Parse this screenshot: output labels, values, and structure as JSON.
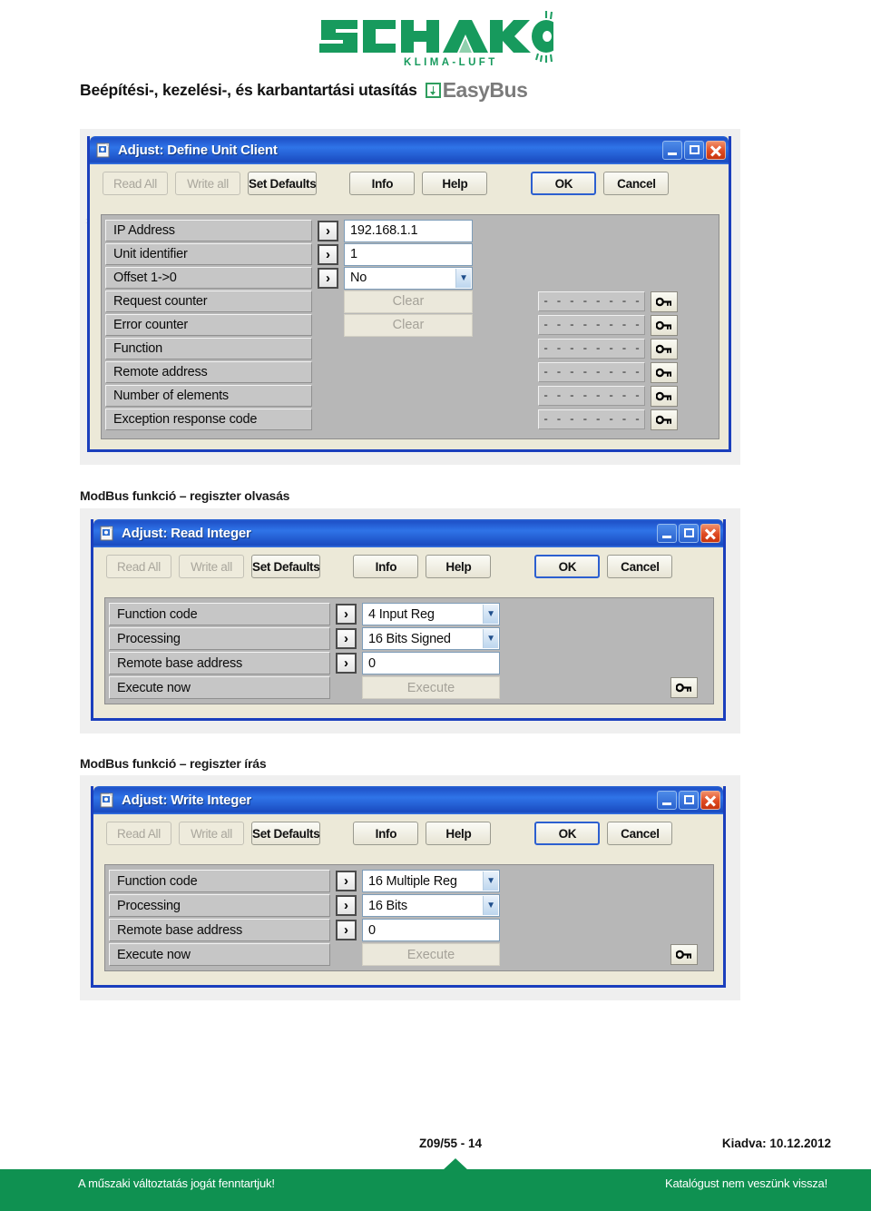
{
  "brand": {
    "logo_text": "SCHAKO",
    "logo_tagline": "KLIMA-LUFT",
    "logo_color": "#179a5d"
  },
  "header": {
    "title": "Beépítési-, kezelési-, és karbantartási utasítás",
    "product": "EasyBus",
    "product_icon": "easybus-mark-icon"
  },
  "toolbar_labels": {
    "read_all": "Read All",
    "write_all": "Write all",
    "set_defaults": "Set Defaults",
    "info": "Info",
    "help": "Help",
    "ok": "OK",
    "cancel": "Cancel"
  },
  "windows": [
    {
      "title": "Adjust: Define Unit Client",
      "rows": [
        {
          "label": "IP Address",
          "control": "text",
          "value": "192.168.1.1",
          "arrow": true,
          "dash": false,
          "key": false
        },
        {
          "label": "Unit identifier",
          "control": "text",
          "value": "1",
          "arrow": true,
          "dash": false,
          "key": false
        },
        {
          "label": "Offset 1->0",
          "control": "combo",
          "value": "No",
          "arrow": true,
          "dash": false,
          "key": false
        },
        {
          "label": "Request counter",
          "control": "button",
          "value": "Clear",
          "arrow": false,
          "dash": true,
          "key": true
        },
        {
          "label": "Error counter",
          "control": "button",
          "value": "Clear",
          "arrow": false,
          "dash": true,
          "key": true
        },
        {
          "label": "Function",
          "control": "none",
          "value": "",
          "arrow": false,
          "dash": true,
          "key": true
        },
        {
          "label": "Remote address",
          "control": "none",
          "value": "",
          "arrow": false,
          "dash": true,
          "key": true
        },
        {
          "label": "Number of elements",
          "control": "none",
          "value": "",
          "arrow": false,
          "dash": true,
          "key": true
        },
        {
          "label": "Exception response code",
          "control": "none",
          "value": "",
          "arrow": false,
          "dash": true,
          "key": true
        }
      ]
    },
    {
      "title": "Adjust: Read Integer",
      "caption": "ModBus funkció – regiszter olvasás",
      "rows": [
        {
          "label": "Function code",
          "control": "combo",
          "value": "4 Input Reg",
          "arrow": true,
          "key": false
        },
        {
          "label": "Processing",
          "control": "combo",
          "value": "16 Bits Signed",
          "arrow": true,
          "key": false
        },
        {
          "label": "Remote base address",
          "control": "text",
          "value": "0",
          "arrow": true,
          "key": false
        },
        {
          "label": "Execute now",
          "control": "button",
          "value": "Execute",
          "arrow": false,
          "key": true
        }
      ]
    },
    {
      "title": "Adjust: Write Integer",
      "caption": "ModBus funkció – regiszter írás",
      "rows": [
        {
          "label": "Function code",
          "control": "combo",
          "value": "16 Multiple Reg",
          "arrow": true,
          "key": false
        },
        {
          "label": "Processing",
          "control": "combo",
          "value": "16 Bits",
          "arrow": true,
          "key": false
        },
        {
          "label": "Remote base address",
          "control": "text",
          "value": "0",
          "arrow": true,
          "key": false
        },
        {
          "label": "Execute now",
          "control": "button",
          "value": "Execute",
          "arrow": false,
          "key": true
        }
      ]
    }
  ],
  "dash_value": "- - - - - - - - - - - - - - - - - - - -",
  "footer": {
    "page_code": "Z09/55 - 14",
    "issue": "Kiadva: 10.12.2012",
    "left_note": "A műszaki változtatás jogát fenntartjuk!",
    "right_note": "Katalógust nem veszünk vissza!",
    "bar_color": "#0f9151"
  }
}
